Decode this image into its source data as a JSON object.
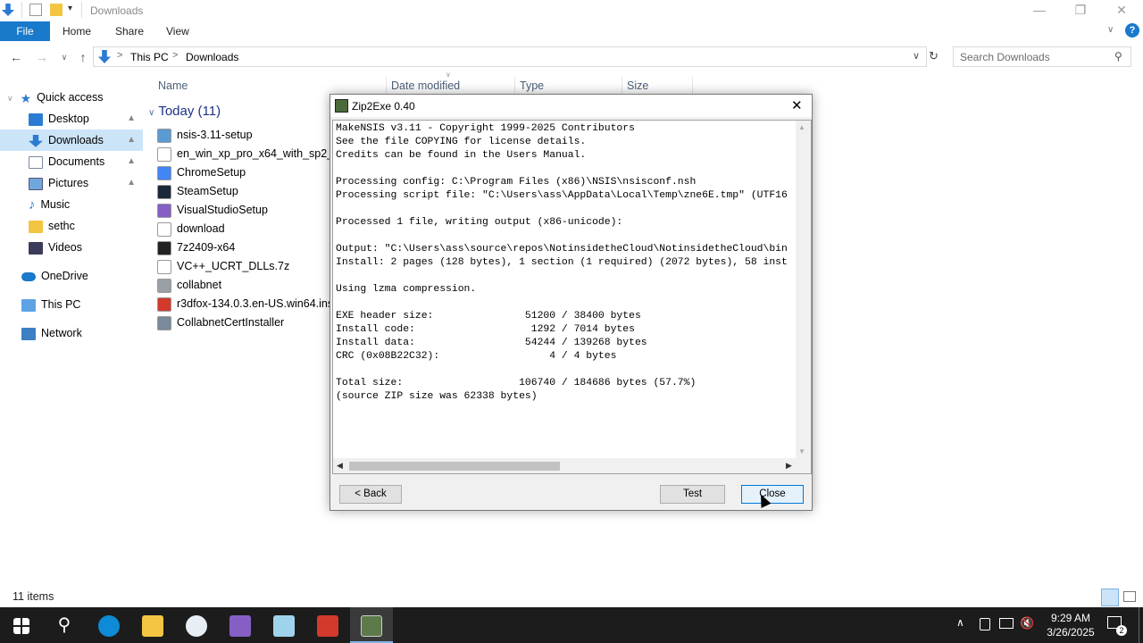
{
  "window": {
    "title": "Downloads"
  },
  "ribbon": {
    "file": "File",
    "home": "Home",
    "share": "Share",
    "view": "View"
  },
  "address": {
    "this_pc": "This PC",
    "sep": ">",
    "downloads": "Downloads"
  },
  "search": {
    "placeholder": "Search Downloads"
  },
  "sidebar": {
    "items": [
      {
        "label": "Quick access",
        "icon": "star-icon"
      },
      {
        "label": "Desktop",
        "icon": "desktop-icon"
      },
      {
        "label": "Downloads",
        "icon": "download-icon"
      },
      {
        "label": "Documents",
        "icon": "documents-icon"
      },
      {
        "label": "Pictures",
        "icon": "pictures-icon"
      },
      {
        "label": "Music",
        "icon": "music-icon"
      },
      {
        "label": "sethc",
        "icon": "folder-icon"
      },
      {
        "label": "Videos",
        "icon": "videos-icon"
      },
      {
        "label": "OneDrive",
        "icon": "cloud-icon"
      },
      {
        "label": "This PC",
        "icon": "computer-icon"
      },
      {
        "label": "Network",
        "icon": "network-icon"
      }
    ]
  },
  "columns": {
    "name": "Name",
    "date": "Date modified",
    "type": "Type",
    "size": "Size"
  },
  "group": {
    "label": "Today (11)"
  },
  "files": [
    {
      "name": "nsis-3.11-setup",
      "color": "#5a9bd4"
    },
    {
      "name": "en_win_xp_pro_x64_with_sp2_vl_",
      "color": "#ffffff"
    },
    {
      "name": "ChromeSetup",
      "color": "#4285f4"
    },
    {
      "name": "SteamSetup",
      "color": "#1b2838"
    },
    {
      "name": "VisualStudioSetup",
      "color": "#865fc5"
    },
    {
      "name": "download",
      "color": "#ffffff"
    },
    {
      "name": "7z2409-x64",
      "color": "#222222"
    },
    {
      "name": "VC++_UCRT_DLLs.7z",
      "color": "#ffffff"
    },
    {
      "name": "collabnet",
      "color": "#9aa0a6"
    },
    {
      "name": "r3dfox-134.0.3.en-US.win64.insta",
      "color": "#d33a2c"
    },
    {
      "name": "CollabnetCertInstaller",
      "color": "#7a8a9a"
    }
  ],
  "status": {
    "items": "11 items"
  },
  "dialog": {
    "title": "Zip2Exe 0.40",
    "log": "MakeNSIS v3.11 - Copyright 1999-2025 Contributors\nSee the file COPYING for license details.\nCredits can be found in the Users Manual.\n\nProcessing config: C:\\Program Files (x86)\\NSIS\\nsisconf.nsh\nProcessing script file: \"C:\\Users\\ass\\AppData\\Local\\Temp\\zne6E.tmp\" (UTF16\n\nProcessed 1 file, writing output (x86-unicode):\n\nOutput: \"C:\\Users\\ass\\source\\repos\\NotinsidetheCloud\\NotinsidetheCloud\\bin\nInstall: 2 pages (128 bytes), 1 section (1 required) (2072 bytes), 58 inst\n\nUsing lzma compression.\n\nEXE header size:               51200 / 38400 bytes\nInstall code:                   1292 / 7014 bytes\nInstall data:                  54244 / 139268 bytes\nCRC (0x08B22C32):                  4 / 4 bytes\n\nTotal size:                   106740 / 184686 bytes (57.7%)\n(source ZIP size was 62338 bytes)",
    "back": "< Back",
    "test": "Test",
    "close": "Close"
  },
  "taskbar": {
    "time": "9:29 AM",
    "date": "3/26/2025"
  },
  "colors": {
    "accent": "#1979ca",
    "selection": "#cce4f7",
    "taskbar": "#1c1c1c"
  }
}
